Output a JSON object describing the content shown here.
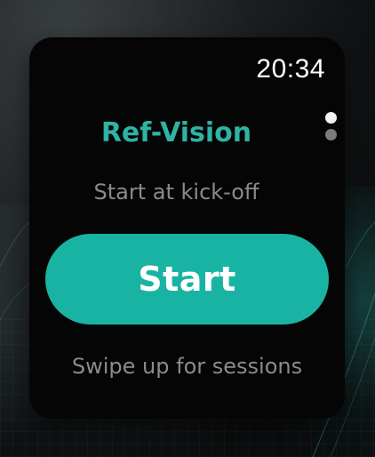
{
  "status_bar": {
    "time": "20:34"
  },
  "app": {
    "title": "Ref-Vision",
    "subtitle": "Start at kick-off",
    "start_label": "Start",
    "hint": "Swipe up for sessions"
  },
  "page_indicator": {
    "total": 2,
    "active_index": 0
  },
  "colors": {
    "accent": "#19b3a3",
    "title_color": "#2fb3a5",
    "muted_text": "#8a8a90",
    "screen_background": "#050505"
  }
}
